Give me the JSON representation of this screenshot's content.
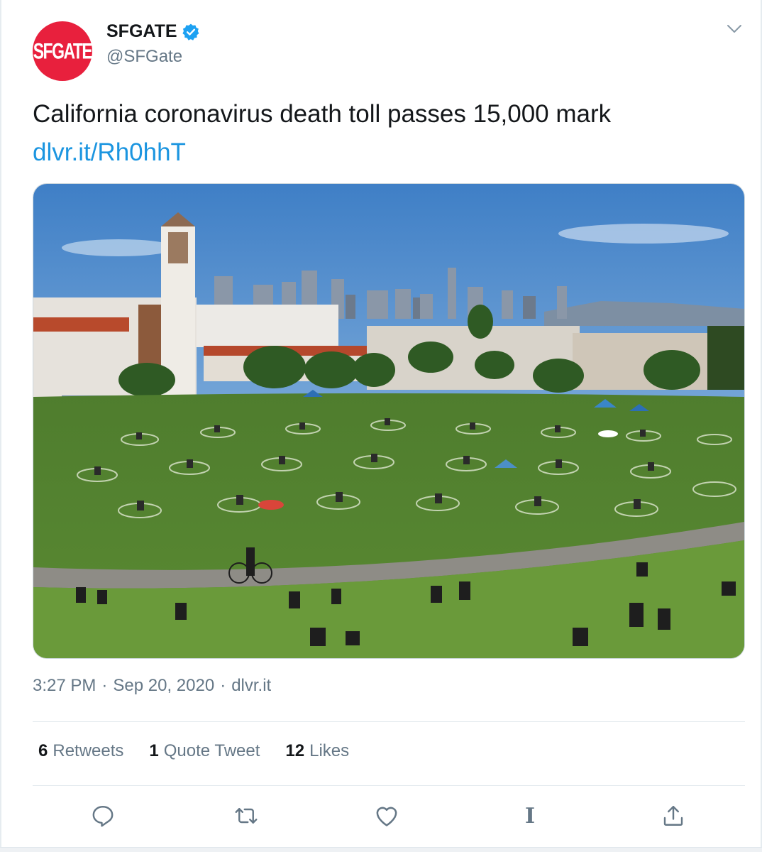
{
  "author": {
    "avatar_text": "SFGATE",
    "display_name": "SFGATE",
    "handle": "@SFGate",
    "verified": true,
    "brand_color": "#e8203d",
    "verified_color": "#1da1f2"
  },
  "tweet": {
    "text": "California coronavirus death toll passes 15,000 mark",
    "link": "dlvr.it/Rh0hhT",
    "link_color": "#1b95e0",
    "time": "3:27 PM",
    "date": "Sep 20, 2020",
    "source": "dlvr.it"
  },
  "stats": {
    "retweets_count": "6",
    "retweets_label": "Retweets",
    "quotes_count": "1",
    "quotes_label": "Quote Tweet",
    "likes_count": "12",
    "likes_label": "Likes"
  },
  "actions": {
    "reply_icon": "reply-icon",
    "retweet_icon": "retweet-icon",
    "like_icon": "heart-icon",
    "extra_glyph": "I",
    "share_icon": "share-icon"
  },
  "media": {
    "kind": "photo",
    "scene": "park-with-crowd-and-city-skyline"
  }
}
